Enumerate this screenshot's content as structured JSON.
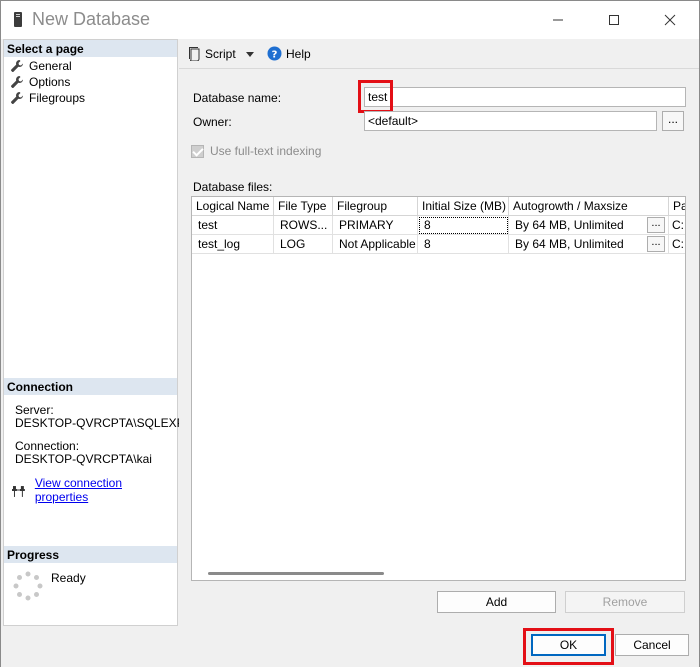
{
  "window": {
    "title": "New Database"
  },
  "left": {
    "select_page_header": "Select a page",
    "pages": [
      "General",
      "Options",
      "Filegroups"
    ],
    "connection_header": "Connection",
    "server_label": "Server:",
    "server_value": "DESKTOP-QVRCPTA\\SQLEXPRE",
    "connection_label": "Connection:",
    "connection_value": "DESKTOP-QVRCPTA\\kai",
    "view_link": "View connection properties",
    "progress_header": "Progress",
    "progress_status": "Ready"
  },
  "toolbar": {
    "script_label": "Script",
    "help_label": "Help"
  },
  "form": {
    "db_name_label": "Database name:",
    "db_name_value": "test",
    "owner_label": "Owner:",
    "owner_value": "<default>",
    "browse_label": "...",
    "fulltext_label": "Use full-text indexing",
    "files_label": "Database files:"
  },
  "grid": {
    "columns": [
      "Logical Name",
      "File Type",
      "Filegroup",
      "Initial Size (MB)",
      "Autogrowth / Maxsize",
      "Pa"
    ],
    "rows": [
      [
        "test",
        "ROWS...",
        "PRIMARY",
        "8",
        "By 64 MB, Unlimited",
        "C:"
      ],
      [
        "test_log",
        "LOG",
        "Not Applicable",
        "8",
        "By 64 MB, Unlimited",
        "C:"
      ]
    ],
    "cell_button": "..."
  },
  "buttons": {
    "add": "Add",
    "remove": "Remove",
    "ok": "OK",
    "cancel": "Cancel"
  },
  "colors": {
    "highlight": "#e30f16",
    "link": "#0000ee",
    "header_bg": "#dde6f0"
  }
}
